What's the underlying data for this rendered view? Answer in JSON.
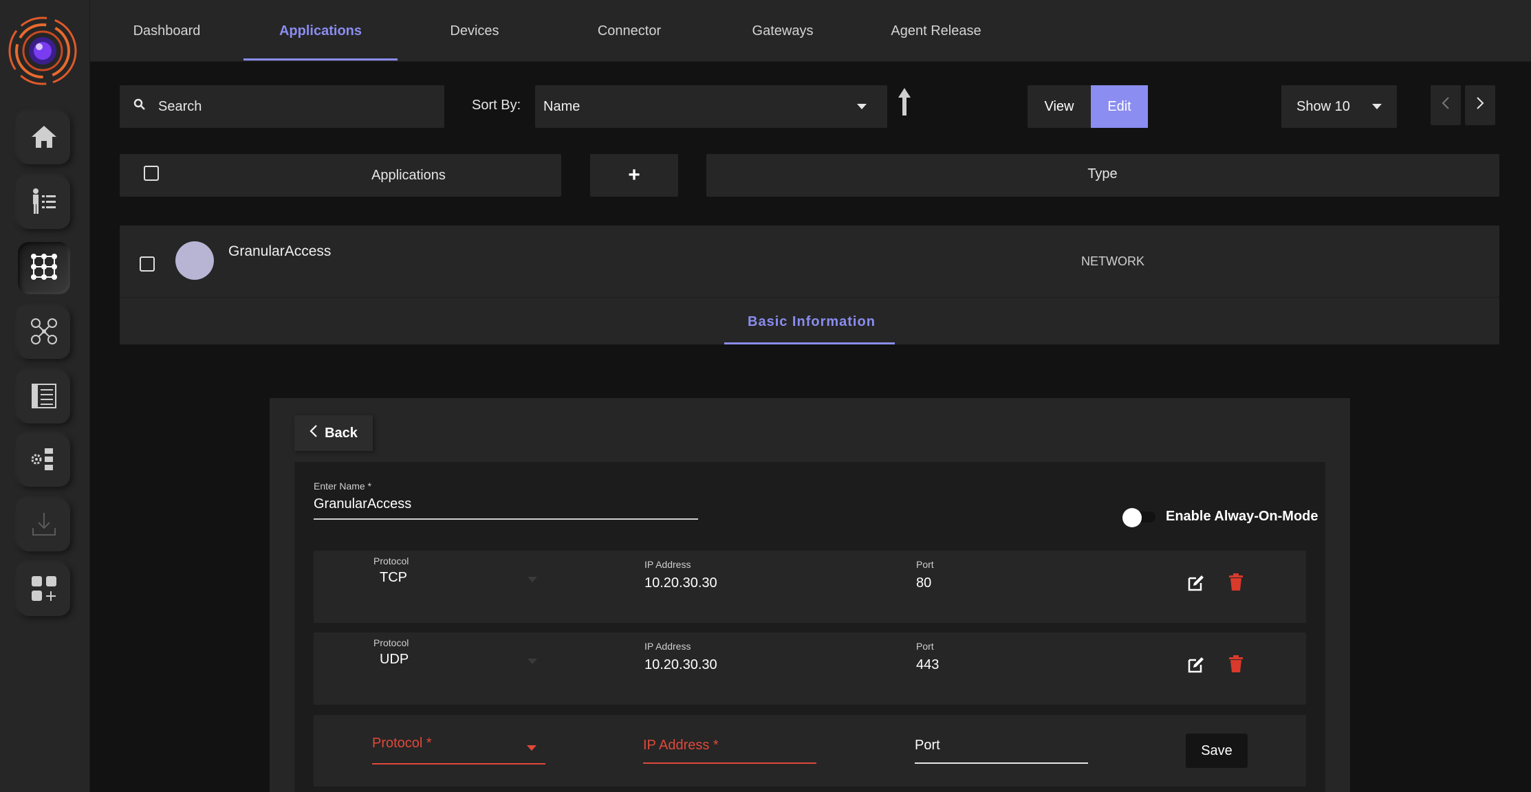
{
  "nav": {
    "tabs": [
      {
        "label": "Dashboard"
      },
      {
        "label": "Applications"
      },
      {
        "label": "Devices"
      },
      {
        "label": "Connector"
      },
      {
        "label": "Gateways"
      },
      {
        "label": "Agent Release"
      }
    ],
    "active_tab": "Applications"
  },
  "toolbar": {
    "search_placeholder": "Search",
    "sort_label": "Sort By:",
    "sort_value": "Name",
    "view_label": "View",
    "edit_label": "Edit",
    "show_value": "Show 10"
  },
  "table": {
    "header_applications": "Applications",
    "add_symbol": "+",
    "header_type": "Type",
    "row": {
      "name": "GranularAccess",
      "type": "NETWORK"
    }
  },
  "detail": {
    "tab_label": "Basic Information",
    "back_label": "Back",
    "name_label": "Enter Name *",
    "name_value": "GranularAccess",
    "toggle_label": "Enable Alway-On-Mode",
    "toggle_on": false,
    "rules": [
      {
        "protocol_label": "Protocol",
        "protocol": "TCP",
        "ip_label": "IP Address",
        "ip": "10.20.30.30",
        "port_label": "Port",
        "port": "80"
      },
      {
        "protocol_label": "Protocol",
        "protocol": "UDP",
        "ip_label": "IP Address",
        "ip": "10.20.30.30",
        "port_label": "Port",
        "port": "443"
      }
    ],
    "new_rule": {
      "protocol_placeholder": "Protocol *",
      "ip_placeholder": "IP Address *",
      "port_placeholder": "Port",
      "save_label": "Save"
    }
  },
  "colors": {
    "accent": "#8b8df0",
    "error": "#e0483a",
    "delete": "#d93a2b",
    "avatar": "#b7b4d4"
  },
  "icons": [
    "app-logo-icon",
    "home-icon",
    "user-list-icon",
    "grid-icon",
    "people-network-icon",
    "document-list-icon",
    "gear-list-icon",
    "download-icon",
    "widgets-icon",
    "search-icon",
    "arrow-up-icon",
    "chevron-left-icon",
    "chevron-right-icon",
    "edit-icon",
    "trash-icon"
  ]
}
